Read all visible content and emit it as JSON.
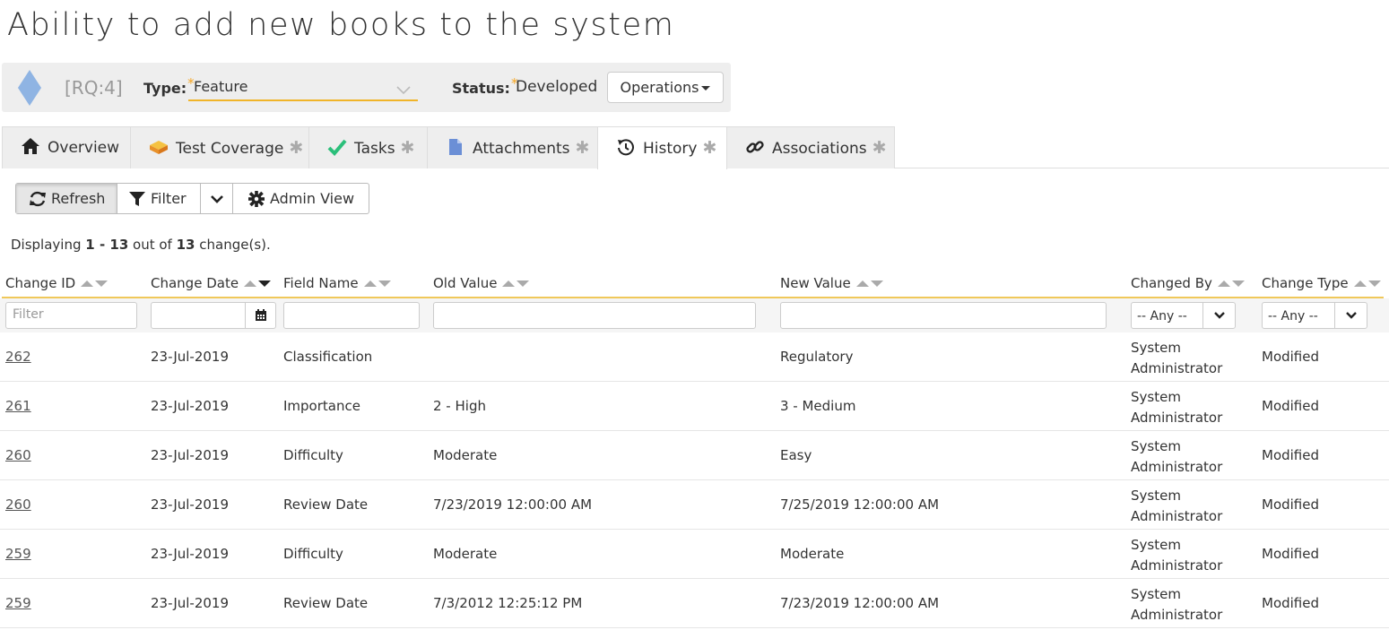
{
  "page": {
    "title": "Ability to add new books to the system"
  },
  "header": {
    "token": "[RQ:4]",
    "type_label": "Type:",
    "type_value": "Feature",
    "status_label": "Status:",
    "status_value": "Developed",
    "operations_label": "Operations",
    "required_marker": "*",
    "icon": "diamond-icon"
  },
  "tabs": [
    {
      "label": "Overview",
      "icon": "home-icon"
    },
    {
      "label": "Test Coverage",
      "icon": "test-coverage-icon",
      "star": "✱"
    },
    {
      "label": "Tasks",
      "icon": "check-icon",
      "star": "✱"
    },
    {
      "label": "Attachments",
      "icon": "document-icon",
      "star": "✱"
    },
    {
      "label": "History",
      "icon": "history-icon",
      "star": "✱",
      "active": true
    },
    {
      "label": "Associations",
      "icon": "link-icon",
      "star": "✱"
    }
  ],
  "toolbar": {
    "refresh_label": "Refresh",
    "filter_label": "Filter",
    "admin_view_label": "Admin View"
  },
  "display": {
    "prefix": "Displaying",
    "range": "1 - 13",
    "out_of": "out of",
    "total": "13",
    "suffix": "change(s)."
  },
  "grid": {
    "columns": [
      "Change ID",
      "Change Date",
      "Field Name",
      "Old Value",
      "New Value",
      "Changed By",
      "Change Type"
    ],
    "filters": {
      "change_id_placeholder": "Filter",
      "changed_by_value": "-- Any --",
      "change_type_value": "-- Any --"
    },
    "rows": [
      {
        "id": "262",
        "date": "23-Jul-2019",
        "field": "Classification",
        "old": "",
        "new": "Regulatory",
        "by_line1": "System",
        "by_line2": "Administrator",
        "type": "Modified"
      },
      {
        "id": "261",
        "date": "23-Jul-2019",
        "field": "Importance",
        "old": "2 - High",
        "new": "3 - Medium",
        "by_line1": "System",
        "by_line2": "Administrator",
        "type": "Modified"
      },
      {
        "id": "260",
        "date": "23-Jul-2019",
        "field": "Difficulty",
        "old": "Moderate",
        "new": "Easy",
        "by_line1": "System",
        "by_line2": "Administrator",
        "type": "Modified"
      },
      {
        "id": "260",
        "date": "23-Jul-2019",
        "field": "Review Date",
        "old": "7/23/2019 12:00:00 AM",
        "new": "7/25/2019 12:00:00 AM",
        "by_line1": "System",
        "by_line2": "Administrator",
        "type": "Modified"
      },
      {
        "id": "259",
        "date": "23-Jul-2019",
        "field": "Difficulty",
        "old": "Moderate",
        "new": "Moderate",
        "by_line1": "System",
        "by_line2": "Administrator",
        "type": "Modified"
      },
      {
        "id": "259",
        "date": "23-Jul-2019",
        "field": "Review Date",
        "old": "7/3/2012 12:25:12 PM",
        "new": "7/23/2019 12:00:00 AM",
        "by_line1": "System",
        "by_line2": "Administrator",
        "type": "Modified"
      }
    ]
  },
  "colors": {
    "accent": "#f0b429",
    "tab_bg": "#eeeeee",
    "header_bg": "#eeeeee",
    "diamond": "#8fb4e3"
  }
}
